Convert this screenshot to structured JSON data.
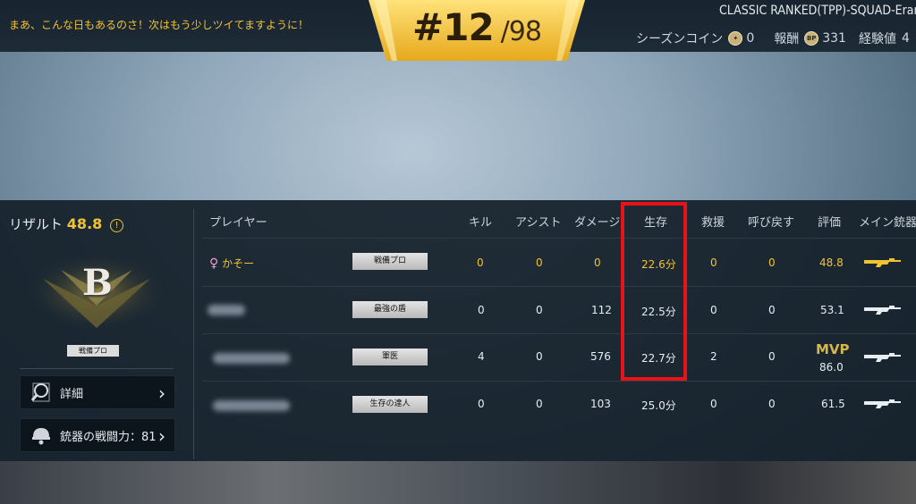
{
  "header": {
    "tagline": "まあ、こんな日もあるのさ！次はもう少しツイてますように！",
    "rank": "#12",
    "total": "/98",
    "mode": "CLASSIC RANKED(TPP)-SQUAD-Erar",
    "season_coin_label": "シーズンコイン",
    "season_coin_value": "0",
    "reward_label": "報酬",
    "reward_icon": "BP",
    "reward_value": "331",
    "exp_label": "経験値",
    "exp_value": "4"
  },
  "result": {
    "label": "リザルト",
    "score": "48.8",
    "info_icon": "!",
    "grade": "B",
    "player_title": "戦備プロ",
    "detail_button": "詳細",
    "weapon_power_button": "銃器の戦闘力：81"
  },
  "table": {
    "headers": {
      "player": "プレイヤー",
      "kill": "キル",
      "assist": "アシスト",
      "damage": "ダメージ",
      "survival": "生存",
      "rescue": "救援",
      "revive": "呼び戻す",
      "rating": "評価",
      "weapon": "メイン銃器"
    },
    "rows": [
      {
        "name": "かそー",
        "gender_icon": "♀",
        "title": "戦備プロ",
        "kill": "0",
        "assist": "0",
        "damage": "0",
        "survival": "22.6分",
        "rescue": "0",
        "revive": "0",
        "rating": "48.8",
        "mvp": ""
      },
      {
        "name": "",
        "title": "最強の盾",
        "kill": "0",
        "assist": "0",
        "damage": "112",
        "survival": "22.5分",
        "rescue": "0",
        "revive": "0",
        "rating": "53.1",
        "mvp": ""
      },
      {
        "name": "",
        "title": "軍医",
        "kill": "4",
        "assist": "0",
        "damage": "576",
        "survival": "22.7分",
        "rescue": "2",
        "revive": "0",
        "rating": "86.0",
        "mvp": "MVP"
      },
      {
        "name": "",
        "title": "生存の達人",
        "kill": "0",
        "assist": "0",
        "damage": "103",
        "survival": "25.0分",
        "rescue": "0",
        "revive": "0",
        "rating": "61.5",
        "mvp": ""
      }
    ]
  },
  "colors": {
    "gold": "#f1c232",
    "highlight_box": "#e8121b",
    "panel": "#14202a"
  },
  "icons": [
    "coin-icon",
    "bp-coin-icon",
    "info-icon",
    "magnifier-icon",
    "helmet-icon",
    "chevron-right-icon",
    "female-icon",
    "rifle-icon"
  ]
}
